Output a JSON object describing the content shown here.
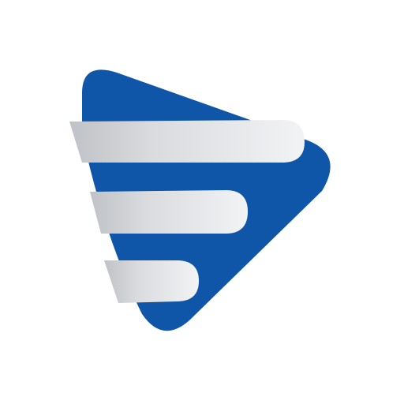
{
  "logo": {
    "icon": "play-triangle-stripes-icon",
    "colors": {
      "background": "#ffffff",
      "triangle": "#0f56a8",
      "stripe_light": "#f2f3f5",
      "stripe_mid": "#d9dbde",
      "stripe_dark": "#bfc2c6"
    },
    "stripe_count": 3
  }
}
